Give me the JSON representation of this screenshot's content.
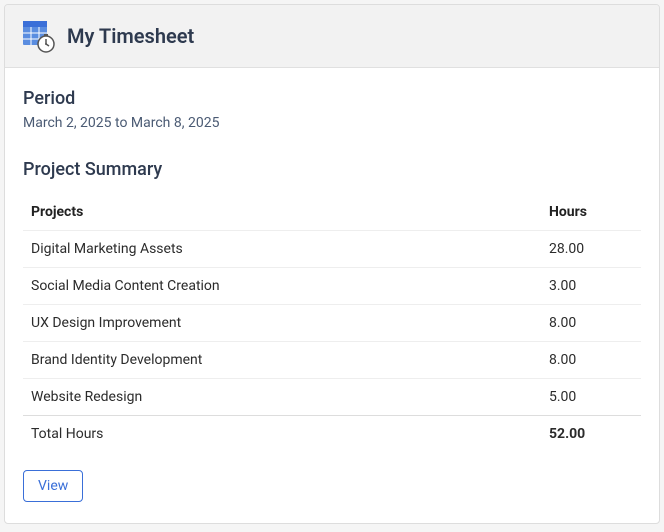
{
  "header": {
    "title": "My Timesheet"
  },
  "period": {
    "label": "Period",
    "text": "March 2, 2025 to March 8, 2025"
  },
  "summary": {
    "title": "Project Summary",
    "columns": {
      "projects": "Projects",
      "hours": "Hours"
    },
    "rows": [
      {
        "project": "Digital Marketing Assets",
        "hours": "28.00"
      },
      {
        "project": "Social Media Content Creation",
        "hours": "3.00"
      },
      {
        "project": "UX Design Improvement",
        "hours": "8.00"
      },
      {
        "project": "Brand Identity Development",
        "hours": "8.00"
      },
      {
        "project": "Website Redesign",
        "hours": "5.00"
      }
    ],
    "total": {
      "label": "Total Hours",
      "hours": "52.00"
    }
  },
  "actions": {
    "view_label": "View"
  }
}
